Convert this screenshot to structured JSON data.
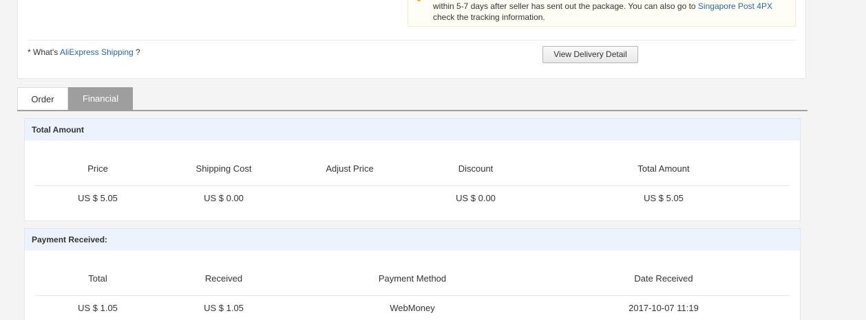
{
  "shipping": {
    "notice_line1": "within 5-7 days after seller has sent out the package. You can also go to ",
    "notice_link": "Singapore Post 4PX",
    "notice_line2": "check the tracking information.",
    "whats_prefix": "* What's ",
    "whats_link": "AliExpress Shipping",
    "whats_suffix": " ?",
    "view_delivery_button": "View Delivery Detail"
  },
  "tabs": [
    {
      "label": "Order",
      "active": false
    },
    {
      "label": "Financial",
      "active": true
    }
  ],
  "total_amount_panel": {
    "title": "Total Amount",
    "headers": [
      "Price",
      "Shipping Cost",
      "Adjust Price",
      "Discount",
      "Total Amount"
    ],
    "values": [
      "US $ 5.05",
      "US $ 0.00",
      "",
      "US $ 0.00",
      "US $ 5.05"
    ]
  },
  "payment_panel": {
    "title": "Payment Received:",
    "headers": [
      "Total",
      "Received",
      "Payment Method",
      "Date Received"
    ],
    "values": [
      "US $ 1.05",
      "US $ 1.05",
      "WebMoney",
      "2017-10-07 11:19"
    ]
  },
  "colors": {
    "link": "#2b65a8",
    "active_tab": "#9e9e9e",
    "panel_header": "#edf3fc",
    "notice_bullet": "#f5a623"
  }
}
